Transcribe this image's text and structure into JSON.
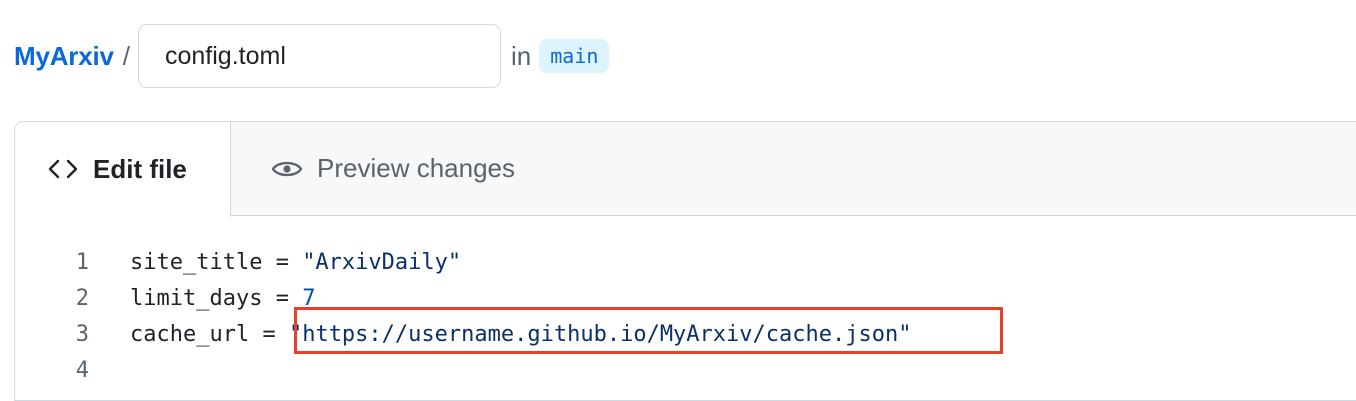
{
  "header": {
    "repo_name": "MyArxiv",
    "separator": "/",
    "filename_value": "config.toml",
    "in_label": "in",
    "branch": "main"
  },
  "tabs": [
    {
      "label": "Edit file",
      "icon": "code-icon",
      "active": true
    },
    {
      "label": "Preview changes",
      "icon": "eye-icon",
      "active": false
    }
  ],
  "code_lines": [
    {
      "number": "1",
      "key": "site_title = ",
      "value": "\"ArxivDaily\""
    },
    {
      "number": "2",
      "key": "limit_days = ",
      "value": "7"
    },
    {
      "number": "3",
      "key": "cache_url = ",
      "value": "\"https://username.github.io/MyArxiv/cache.json\""
    },
    {
      "number": "4",
      "key": "",
      "value": ""
    }
  ],
  "colors": {
    "link": "#0969da",
    "branch_bg": "#ddf4ff",
    "string": "#0a3069",
    "number": "#0550ae",
    "highlight_box": "#e5402b"
  }
}
